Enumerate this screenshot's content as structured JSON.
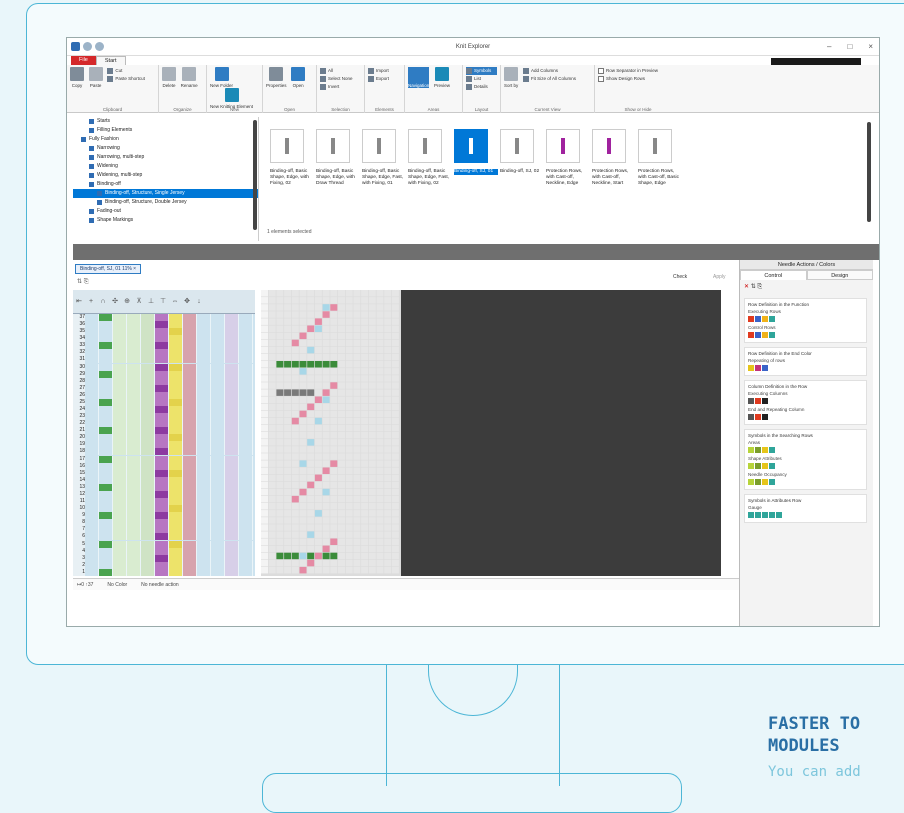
{
  "app": {
    "title": "Knit Explorer",
    "tab_file": "File",
    "tab_start": "Start"
  },
  "ribbon": {
    "clipboard": {
      "name": "Clipboard",
      "copy": "Copy",
      "paste": "Paste",
      "cut": "Cut",
      "paste_shortcut": "Paste Shortcut"
    },
    "organize": {
      "name": "Organize",
      "delete": "Delete",
      "rename": "Rename"
    },
    "new": {
      "name": "New",
      "new_folder": "New Folder",
      "new_knitting_element": "New Knitting Element"
    },
    "open": {
      "name": "Open",
      "properties": "Properties",
      "open": "Open"
    },
    "selection": {
      "name": "Selection",
      "all": "All",
      "select_none": "Select None",
      "invert": "Invert"
    },
    "elements": {
      "name": "Elements",
      "import": "Import",
      "export": "Export"
    },
    "areas": {
      "name": "Areas",
      "navigation": "Navigation",
      "preview": "Preview"
    },
    "layout": {
      "name": "Layout",
      "symbols": "Symbols",
      "list": "List",
      "details": "Details"
    },
    "current_view": {
      "name": "Current View",
      "sort_by": "Sort by",
      "add_columns": "Add Columns",
      "fit_size": "Fit Size of All Columns"
    },
    "show_hide": {
      "name": "Show or Hide",
      "row_separator": "Row Separator in Preview",
      "show_design_rows": "Show Design Rows"
    }
  },
  "tree": [
    {
      "label": "Starts",
      "indent": 2
    },
    {
      "label": "Filling Elements",
      "indent": 2
    },
    {
      "label": "Fully Fashion",
      "indent": 1
    },
    {
      "label": "Narrowing",
      "indent": 2
    },
    {
      "label": "Narrowing, multi-step",
      "indent": 2
    },
    {
      "label": "Widening",
      "indent": 2
    },
    {
      "label": "Widening, multi-step",
      "indent": 2
    },
    {
      "label": "Binding-off",
      "indent": 2
    },
    {
      "label": "Binding-off, Structure, Single Jersey",
      "indent": 3,
      "selected": true
    },
    {
      "label": "Binding-off, Structure, Double Jersey",
      "indent": 3
    },
    {
      "label": "Fading-out",
      "indent": 2
    },
    {
      "label": "Shape Markings",
      "indent": 2
    }
  ],
  "thumbnails": [
    {
      "caption": "Binding-off, Basic Shape, Edge, with Fixing, 02",
      "selected": false,
      "accent": "#888"
    },
    {
      "caption": "Binding-off, Basic Shape, Edge, with Draw Thread",
      "selected": false,
      "accent": "#888"
    },
    {
      "caption": "Binding-off, Basic Shape, Edge, Fast, with Fixing, 01",
      "selected": false,
      "accent": "#888"
    },
    {
      "caption": "Binding-off, Basic Shape, Edge, Fast, with Fixing, 02",
      "selected": false,
      "accent": "#888"
    },
    {
      "caption": "Binding-off, SJ, 01",
      "selected": true,
      "accent": "#fff"
    },
    {
      "caption": "Binding-off, SJ, 02",
      "selected": false,
      "accent": "#888"
    },
    {
      "caption": "Protection Rows, with Cast-off, Neckline, Edge",
      "selected": false,
      "accent": "#a0229e"
    },
    {
      "caption": "Protection Rows, with Cast-off, Neckline, Start",
      "selected": false,
      "accent": "#a0229e"
    },
    {
      "caption": "Protection Rows, with Cast-off, Basic Shape, Edge",
      "selected": false,
      "accent": "#888"
    }
  ],
  "status": {
    "selected_count": "1 elements selected"
  },
  "editor": {
    "doc_tab": "Binding-off, SJ, 01  11%  ×",
    "check": "Check",
    "apply": "Apply",
    "row_numbers": [
      "37",
      "36",
      "35",
      "34",
      "33",
      "32",
      "31",
      "30",
      "29",
      "28",
      "27",
      "26",
      "25",
      "24",
      "23",
      "22",
      "21",
      "20",
      "19",
      "18",
      "17",
      "16",
      "15",
      "14",
      "13",
      "12",
      "11",
      "10",
      "9",
      "8",
      "7",
      "6",
      "5",
      "4",
      "3",
      "2",
      "1"
    ],
    "bottom": {
      "pos": "↦0  ↑37",
      "color": "No Color",
      "needle": "No needle action"
    }
  },
  "panel": {
    "title": "Needle Actions / Colors",
    "tab_control": "Control",
    "tab_design": "Design",
    "sections": [
      {
        "title": "Row Definition in the Function",
        "lines": [
          "Executing Rows",
          "Control Rows"
        ]
      },
      {
        "title": "Row Definition in the End Color",
        "lines": [
          "Repeating of rows"
        ]
      },
      {
        "title": "Column Definition in the Row",
        "lines": [
          "Executing Columns",
          "End and Repeating Column"
        ]
      },
      {
        "title": "Symbols in the Searching Rows",
        "lines": [
          "Areas",
          "Shape Attributes",
          "Needle Occupancy"
        ]
      },
      {
        "title": "Symbols in Attributes Row",
        "lines": [
          "Gauge"
        ]
      }
    ]
  },
  "promo": {
    "title": "FASTER TO",
    "title2": "MODULES",
    "text": "You can add"
  }
}
